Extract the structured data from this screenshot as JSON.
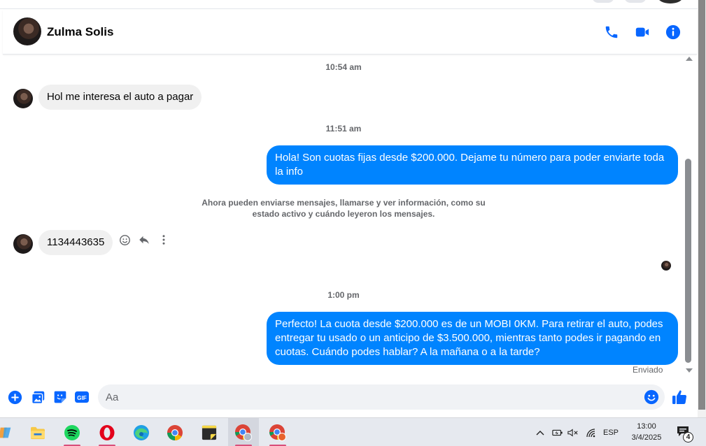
{
  "header": {
    "contact_name": "Zulma Solis"
  },
  "thread": {
    "messages": [
      {
        "type": "time",
        "text": "10:54 am"
      },
      {
        "type": "incoming",
        "text": "Hol me interesa el auto a pagar"
      },
      {
        "type": "time",
        "text": "11:51 am"
      },
      {
        "type": "outgoing",
        "text": "Hola! Son cuotas fijas desde $200.000. Dejame tu número para poder enviarte toda la info"
      },
      {
        "type": "notice",
        "text": "Ahora pueden enviarse mensajes, llamarse y ver información, como su estado activo y cuándo leyeron los mensajes."
      },
      {
        "type": "incoming",
        "text": "1134443635"
      },
      {
        "type": "time",
        "text": "1:00 pm"
      },
      {
        "type": "outgoing",
        "text": "Perfecto! La cuota desde $200.000 es de un MOBI 0KM. Para retirar el auto, podes entregar tu usado o un anticipo de $3.500.000, mientras tanto podes ir pagando en cuotas. Cuándo podes hablar? A la mañana o a la tarde?"
      }
    ],
    "sent_status": "Enviado"
  },
  "composer": {
    "placeholder": "Aa",
    "value": "",
    "gif_label": "GIF"
  },
  "taskbar": {
    "apps": [
      "file-explorer",
      "spotify",
      "opera",
      "edge",
      "chrome",
      "sticky-notes",
      "chrome-profile-1",
      "chrome-profile-2"
    ],
    "tray_language": "ESP",
    "clock_time": "13:00",
    "clock_date": "3/4/2025",
    "notification_count": "4"
  },
  "colors": {
    "accent": "#0084ff",
    "icon_blue": "#0866ff",
    "incoming_bubble": "#f0f0f0"
  }
}
